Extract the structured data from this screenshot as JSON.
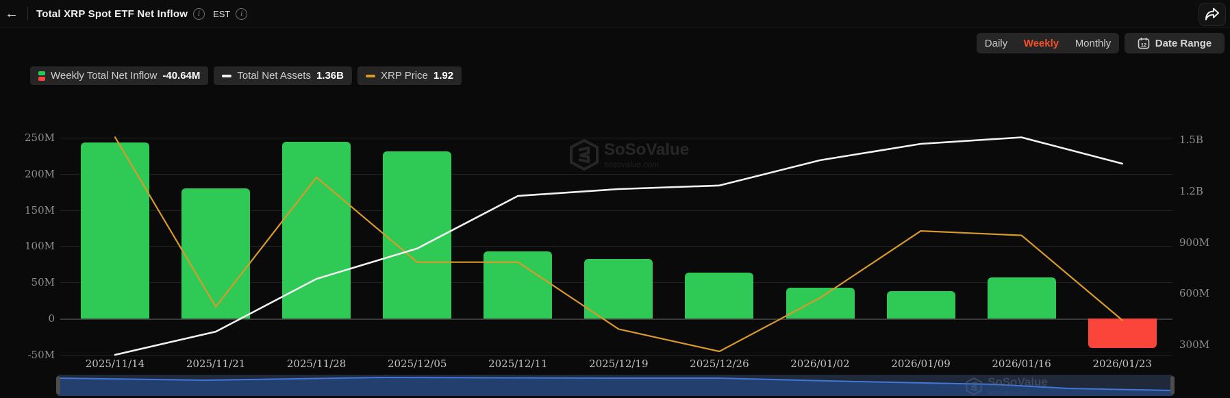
{
  "header": {
    "title": "Total XRP Spot ETF Net Inflow",
    "timezone": "EST"
  },
  "toolbar": {
    "tabs": [
      {
        "label": "Daily",
        "active": false
      },
      {
        "label": "Weekly",
        "active": true
      },
      {
        "label": "Monthly",
        "active": false
      }
    ],
    "date_range": "Date Range",
    "calendar_day": "12"
  },
  "legend": [
    {
      "label": "Weekly Total Net Inflow",
      "value": "-40.64M"
    },
    {
      "label": "Total Net Assets",
      "value": "1.36B"
    },
    {
      "label": "XRP Price",
      "value": "1.92"
    }
  ],
  "watermark": {
    "name": "SoSoValue",
    "domain": "sosovalue.com"
  },
  "colors": {
    "bar_positive": "#2fc956",
    "bar_negative": "#fb453b",
    "line_assets": "#f2f2f2",
    "line_price": "#d89a2b",
    "active_tab": "#f4502a",
    "brush_line": "#4277d6",
    "brush_fill": "#223f6e"
  },
  "chart_data": {
    "type": "bar",
    "title": "Total XRP Spot ETF Net Inflow (Weekly)",
    "categories": [
      "2025/11/14",
      "2025/11/21",
      "2025/11/28",
      "2025/12/05",
      "2025/12/11",
      "2025/12/19",
      "2025/12/26",
      "2026/01/02",
      "2026/01/09",
      "2026/01/16",
      "2026/01/23"
    ],
    "series": [
      {
        "name": "Weekly Total Net Inflow",
        "type": "bar",
        "axis": "left",
        "unit": "M",
        "latest": "-40.64M",
        "values": [
          243.6,
          179.4,
          244.5,
          230.8,
          93.2,
          82.3,
          63.5,
          42.6,
          37.7,
          56.6,
          -40.64
        ]
      },
      {
        "name": "Total Net Assets",
        "type": "line",
        "axis": "right",
        "unit": "M",
        "latest": "1.36B",
        "values": [
          240,
          376,
          685,
          863,
          1171,
          1211,
          1232,
          1380,
          1476,
          1514,
          1360
        ]
      },
      {
        "name": "XRP Price",
        "type": "line",
        "axis": "price",
        "unit": "USD",
        "latest": "1.92",
        "values": [
          2.33,
          1.95,
          2.24,
          2.05,
          2.05,
          1.9,
          1.85,
          1.97,
          2.12,
          2.11,
          1.92
        ]
      }
    ],
    "y_axis_left": {
      "range": [
        -50,
        250
      ],
      "unit": "M",
      "grid": true,
      "ticks": [
        {
          "v": 250,
          "label": "250M"
        },
        {
          "v": 200,
          "label": "200M"
        },
        {
          "v": 150,
          "label": "150M"
        },
        {
          "v": 100,
          "label": "100M"
        },
        {
          "v": 50,
          "label": "50M"
        },
        {
          "v": 0,
          "label": "0"
        },
        {
          "v": -50,
          "label": "-50M"
        }
      ]
    },
    "y_axis_right": {
      "range_M": [
        239,
        1512
      ],
      "grid": false,
      "ticks": [
        {
          "v": 1500,
          "label": "1.5B"
        },
        {
          "v": 1200,
          "label": "1.2B"
        },
        {
          "v": 900,
          "label": "900M"
        },
        {
          "v": 600,
          "label": "600M"
        },
        {
          "v": 300,
          "label": "300M"
        }
      ]
    },
    "price_axis": {
      "hidden": true,
      "range": [
        1.84,
        2.33
      ]
    },
    "legend_position": "top-left"
  }
}
